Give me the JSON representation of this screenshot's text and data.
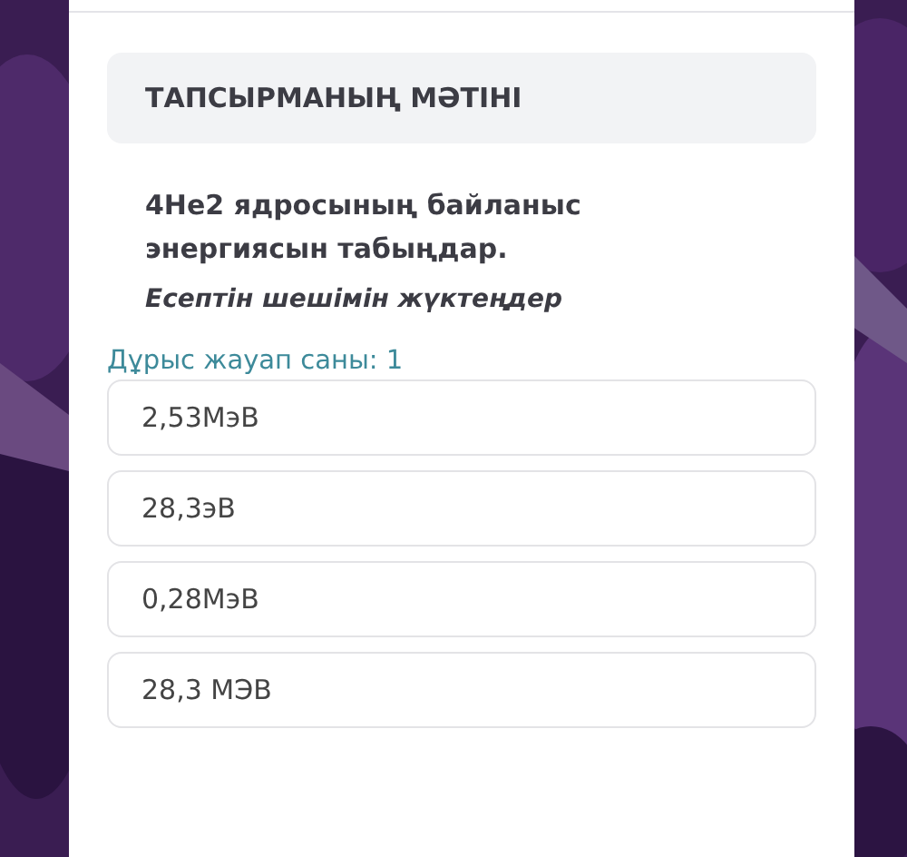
{
  "task": {
    "header": "ТАПСЫРМАНЫҢ МӘТІНІ",
    "question": "4He2 ядросының байланыс энергиясын табыңдар.",
    "instruction": "Есептін шешімін жүктеңдер"
  },
  "correct_count": "Дұрыс жауап саны: 1",
  "options": [
    {
      "label": "2,53МэВ"
    },
    {
      "label": "28,3эВ"
    },
    {
      "label": "0,28МэВ"
    },
    {
      "label": "28,3 МЭВ"
    }
  ]
}
